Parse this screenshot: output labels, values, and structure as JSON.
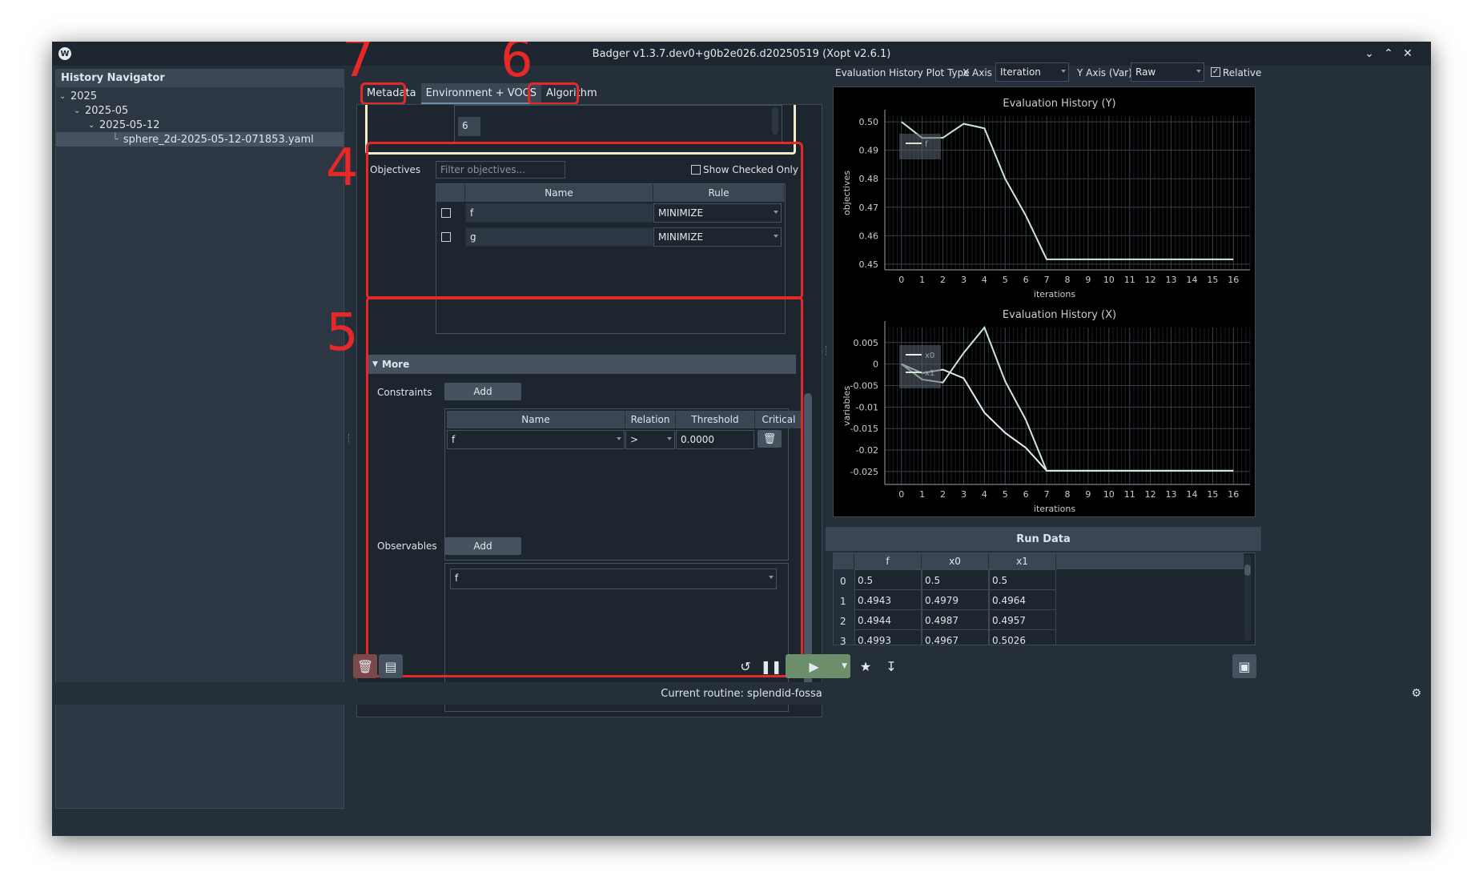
{
  "window": {
    "title": "Badger v1.3.7.dev0+g0b2e026.d20250519 (Xopt v2.6.1)",
    "app_icon": "W"
  },
  "history": {
    "header": "History Navigator",
    "items": [
      {
        "label": "2025"
      },
      {
        "label": "2025-05"
      },
      {
        "label": "2025-05-12"
      },
      {
        "label": "sphere_2d-2025-05-12-071853.yaml"
      }
    ]
  },
  "annotations": {
    "n7": "7",
    "n6": "6",
    "n4": "4",
    "n5": "5"
  },
  "tabs": [
    {
      "label": "Metadata"
    },
    {
      "label": "Environment + VOCS"
    },
    {
      "label": "Algorithm"
    }
  ],
  "variables_box": {
    "value": "6"
  },
  "objectives": {
    "label": "Objectives",
    "filter_placeholder": "Filter objectives...",
    "show_checked_label": "Show Checked Only",
    "columns": [
      "Name",
      "Rule"
    ],
    "rows": [
      {
        "name": "f",
        "rule": "MINIMIZE"
      },
      {
        "name": "g",
        "rule": "MINIMIZE"
      }
    ]
  },
  "more": {
    "label": "More",
    "constraints_label": "Constraints",
    "add_label": "Add",
    "constraint_columns": [
      "Name",
      "Relation",
      "Threshold",
      "Critical"
    ],
    "constraint_row": {
      "name": "f",
      "relation": ">",
      "threshold": "0.0000"
    },
    "observables_label": "Observables",
    "observable_value": "f"
  },
  "plot_controls": {
    "plot_type_label": "Evaluation History Plot Type",
    "x_axis_label": "X Axis",
    "x_axis_value": "Iteration",
    "y_axis_label": "Y Axis (Var)",
    "y_axis_value": "Raw",
    "relative_label": "Relative",
    "relative_checked": true
  },
  "chart_data": [
    {
      "type": "line",
      "title": "Evaluation History (Y)",
      "xlabel": "iterations",
      "ylabel": "objectives",
      "xlim": [
        -0.8,
        16.8
      ],
      "ylim": [
        0.448,
        0.502
      ],
      "xticks": [
        "0",
        "1",
        "2",
        "3",
        "4",
        "5",
        "6",
        "7",
        "8",
        "9",
        "10",
        "11",
        "12",
        "13",
        "14",
        "15",
        "16"
      ],
      "yticks": [
        "0.45",
        "0.46",
        "0.47",
        "0.48",
        "0.49",
        "0.50"
      ],
      "ytick_values": [
        0.45,
        0.46,
        0.47,
        0.48,
        0.49,
        0.5
      ],
      "legend": "top-left",
      "series": [
        {
          "name": "f",
          "color": "#cfe8d4",
          "x": [
            0,
            1,
            2,
            3,
            4,
            5,
            6,
            7,
            8,
            9,
            10,
            11,
            12,
            13,
            14,
            15,
            16
          ],
          "values": [
            0.5,
            0.4943,
            0.4944,
            0.4993,
            0.4977,
            0.48,
            0.467,
            0.4517,
            0.4517,
            0.4517,
            0.4517,
            0.4517,
            0.4517,
            0.4517,
            0.4517,
            0.4517,
            0.4517
          ]
        }
      ]
    },
    {
      "type": "line",
      "title": "Evaluation History (X)",
      "xlabel": "iterations",
      "ylabel": "variables",
      "xlim": [
        -0.8,
        16.8
      ],
      "ylim": [
        -0.028,
        0.0085
      ],
      "xticks": [
        "0",
        "1",
        "2",
        "3",
        "4",
        "5",
        "6",
        "7",
        "8",
        "9",
        "10",
        "11",
        "12",
        "13",
        "14",
        "15",
        "16"
      ],
      "yticks": [
        "0.005",
        "0",
        "-0.005",
        "-0.01",
        "-0.015",
        "-0.02",
        "-0.025"
      ],
      "ytick_values": [
        0.005,
        0,
        -0.005,
        -0.01,
        -0.015,
        -0.02,
        -0.025
      ],
      "legend": "top-left",
      "series": [
        {
          "name": "x0",
          "color": "#e8eef0",
          "x": [
            0,
            1,
            2,
            3,
            4,
            5,
            6,
            7,
            8,
            9,
            10,
            11,
            12,
            13,
            14,
            15,
            16
          ],
          "values": [
            0,
            -0.0021,
            -0.0013,
            -0.0033,
            -0.0113,
            -0.016,
            -0.0195,
            -0.0248,
            -0.0248,
            -0.0248,
            -0.0248,
            -0.0248,
            -0.0248,
            -0.0248,
            -0.0248,
            -0.0248,
            -0.0248
          ]
        },
        {
          "name": "x1",
          "color": "#cfe8d4",
          "x": [
            0,
            1,
            2,
            3,
            4,
            5,
            6,
            7,
            8,
            9,
            10,
            11,
            12,
            13,
            14,
            15,
            16
          ],
          "values": [
            0,
            -0.0036,
            -0.0043,
            0.0026,
            0.0085,
            -0.004,
            -0.013,
            -0.0248,
            -0.0248,
            -0.0248,
            -0.0248,
            -0.0248,
            -0.0248,
            -0.0248,
            -0.0248,
            -0.0248,
            -0.0248
          ]
        }
      ]
    }
  ],
  "run_data": {
    "title": "Run Data",
    "columns": [
      "f",
      "x0",
      "x1"
    ],
    "rows": [
      {
        "idx": "0",
        "f": "0.5",
        "x0": "0.5",
        "x1": "0.5"
      },
      {
        "idx": "1",
        "f": "0.4943",
        "x0": "0.4979",
        "x1": "0.4964"
      },
      {
        "idx": "2",
        "f": "0.4944",
        "x0": "0.4987",
        "x1": "0.4957"
      },
      {
        "idx": "3",
        "f": "0.4993",
        "x0": "0.4967",
        "x1": "0.5026"
      }
    ]
  },
  "status": {
    "text": "Current routine: splendid-fossa"
  },
  "colors": {
    "annotation_red": "#e62828",
    "run_button_green": "#6b8e6b",
    "delete_button_red": "#7a4a4a"
  }
}
